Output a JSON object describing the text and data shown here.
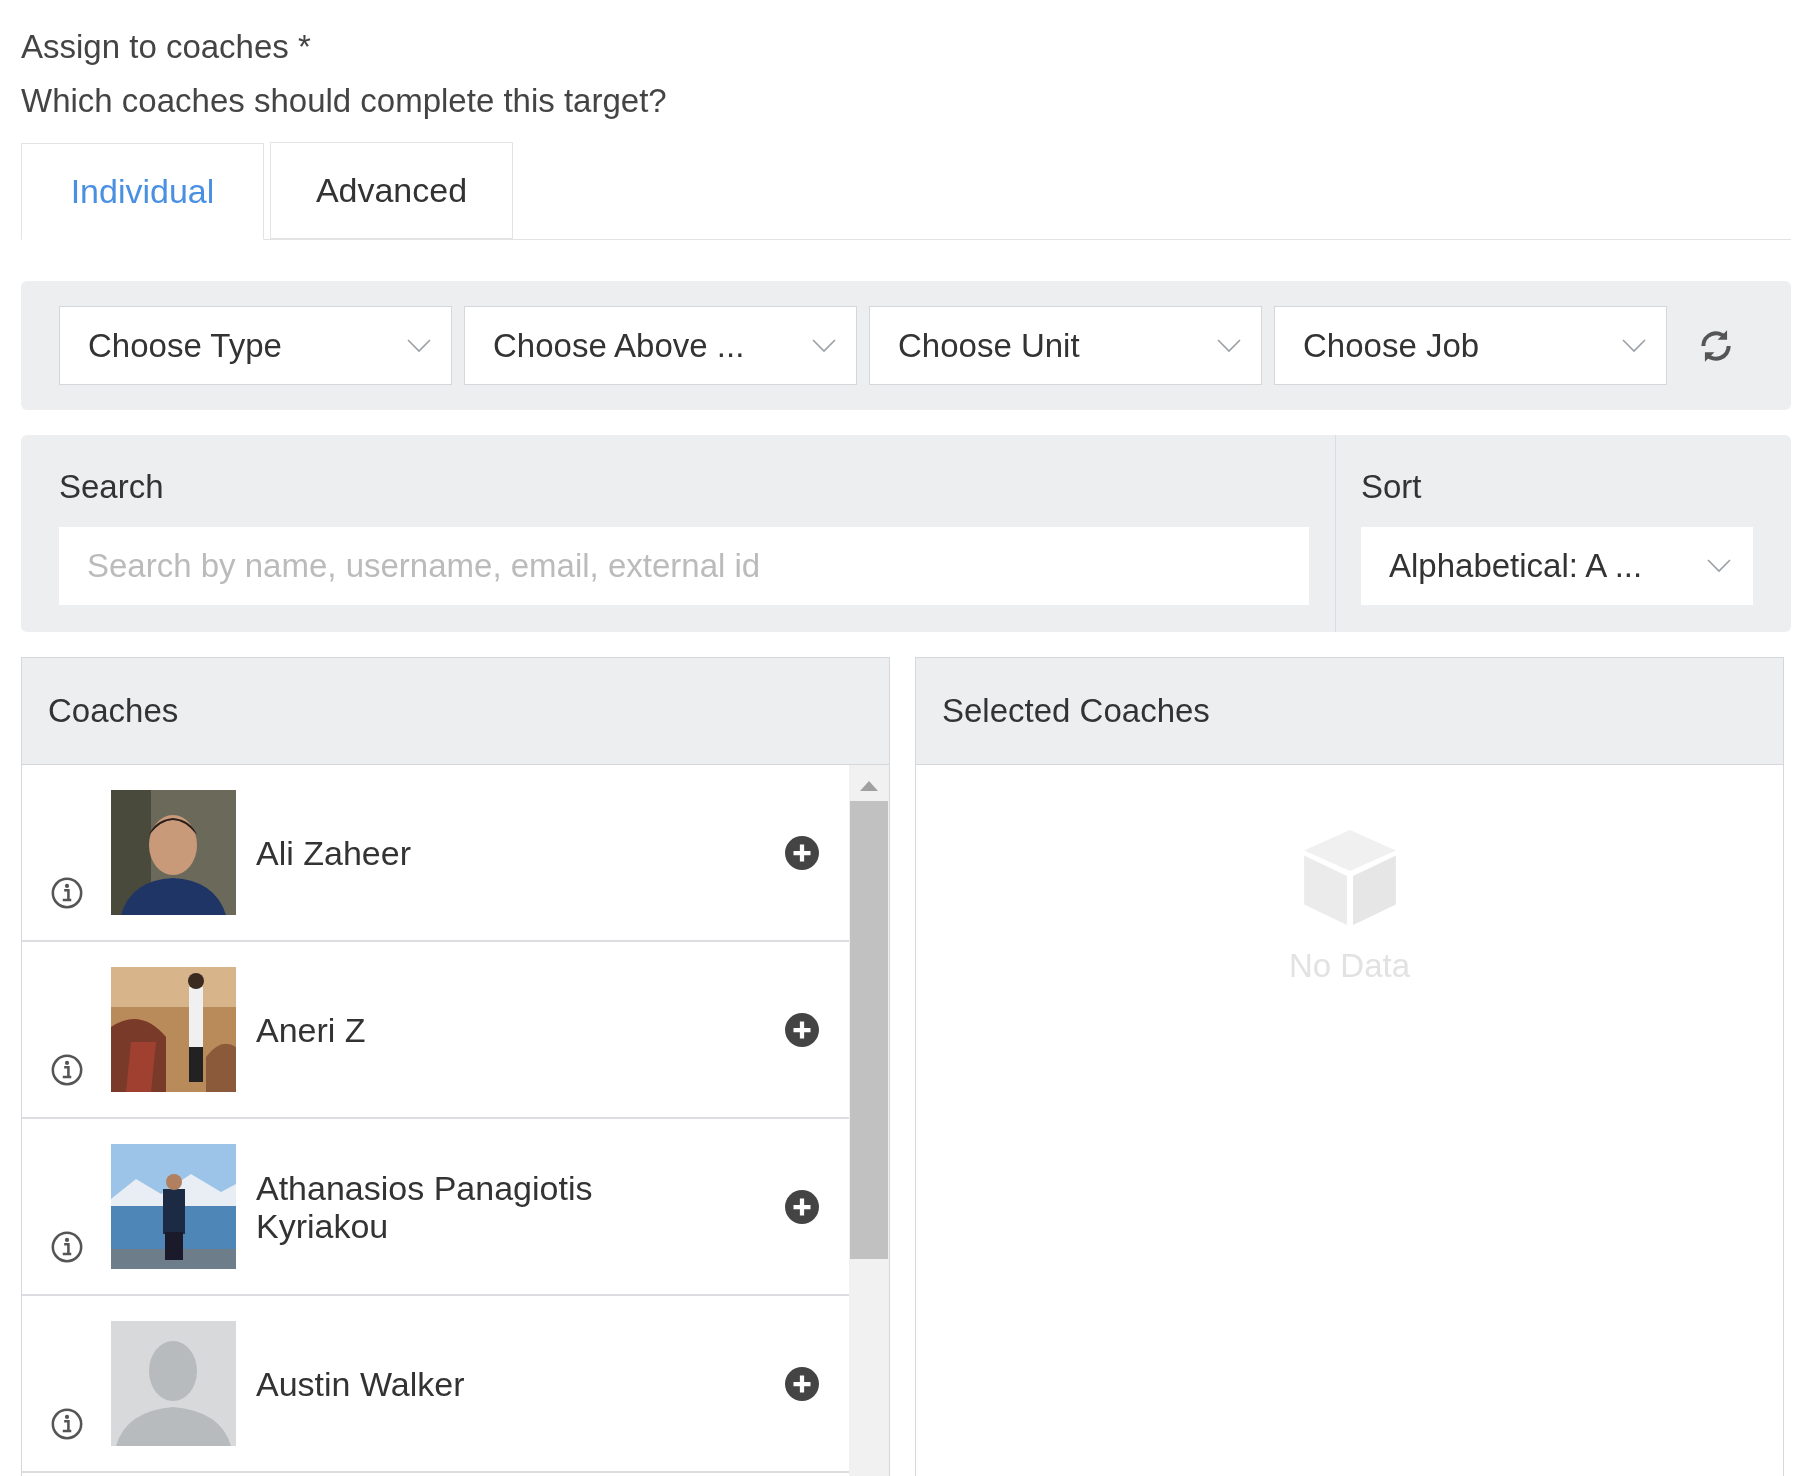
{
  "form": {
    "label": "Assign to coaches *",
    "question": "Which coaches should complete this target?"
  },
  "tabs": [
    {
      "label": "Individual",
      "selected": true
    },
    {
      "label": "Advanced",
      "selected": false
    }
  ],
  "filters": [
    {
      "label": "Choose Type"
    },
    {
      "label": "Choose Above ..."
    },
    {
      "label": "Choose Unit"
    },
    {
      "label": "Choose Job"
    }
  ],
  "search": {
    "label": "Search",
    "placeholder": "Search by name, username, email, external id"
  },
  "sort": {
    "label": "Sort",
    "value": "Alphabetical: A ..."
  },
  "coaches": {
    "title": "Coaches",
    "items": [
      {
        "name": "Ali Zaheer",
        "kind": "picture"
      },
      {
        "name": "Aneri Z",
        "kind": "picture"
      },
      {
        "name": "Athanasios Panagiotis Kyriakou",
        "kind": "picture"
      },
      {
        "name": "Austin Walker",
        "kind": "placeholder"
      }
    ]
  },
  "selected_coaches": {
    "title": "Selected Coaches",
    "empty_text": "No Data"
  }
}
